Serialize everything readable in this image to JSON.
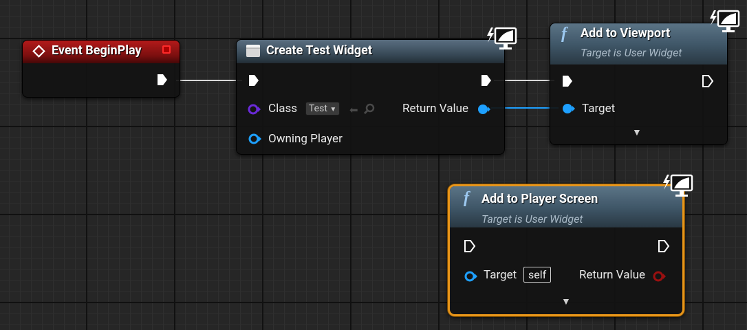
{
  "nodes": {
    "event_begin_play": {
      "title": "Event BeginPlay"
    },
    "create_widget": {
      "title": "Create Test Widget",
      "class_label": "Class",
      "class_value": "Test",
      "owning_player_label": "Owning Player",
      "return_value_label": "Return Value"
    },
    "add_to_viewport": {
      "title": "Add to Viewport",
      "subtitle": "Target is User Widget",
      "target_label": "Target"
    },
    "add_to_player_screen": {
      "title": "Add to Player Screen",
      "subtitle": "Target is User Widget",
      "target_label": "Target",
      "target_default": "self",
      "return_value_label": "Return Value"
    }
  },
  "colors": {
    "exec": "#ffffff",
    "object_pin": "#1ea0ff",
    "class_pin": "#6a2ad8",
    "bool_pin": "#9a1010",
    "event_header": "#8c1212",
    "function_header": "#3e5566",
    "selection": "#e7951a"
  },
  "icons": {
    "event": "event-diamond-icon",
    "function": "function-f-icon",
    "network": "client-monitor-icon",
    "create_widget": "widget-box-icon"
  }
}
